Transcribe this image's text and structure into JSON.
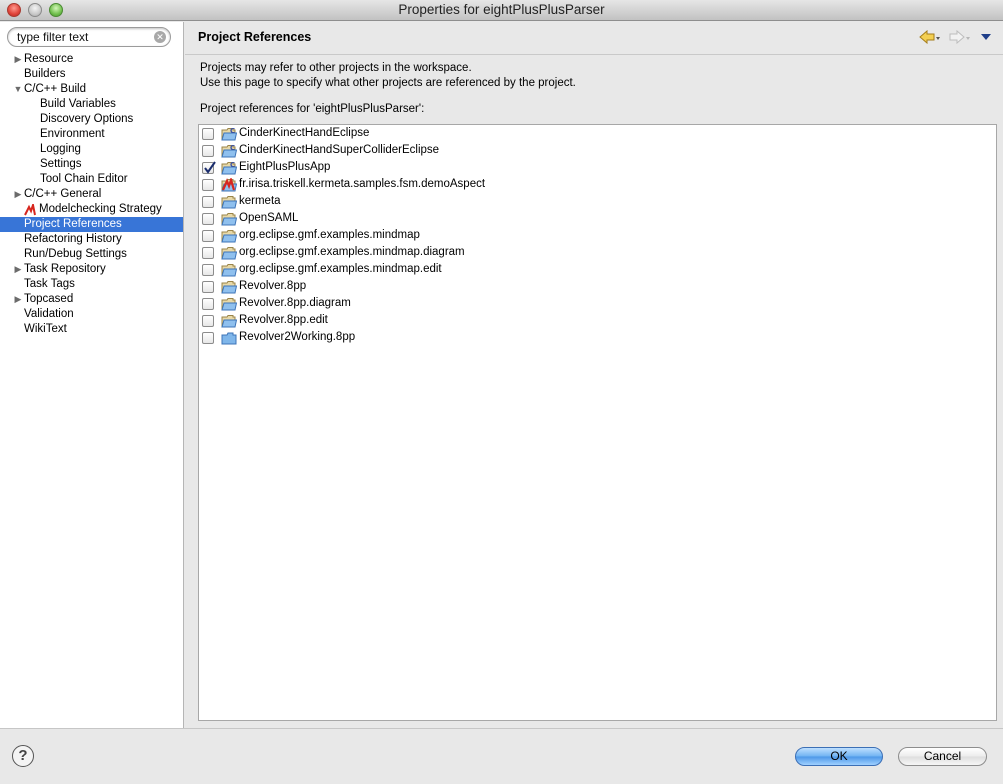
{
  "window": {
    "title": "Properties for eightPlusPlusParser"
  },
  "filter": {
    "value": "type filter text"
  },
  "tree": [
    {
      "label": "Resource",
      "level": 0,
      "expander": "collapsed",
      "selected": false
    },
    {
      "label": "Builders",
      "level": 0,
      "expander": "none",
      "selected": false
    },
    {
      "label": "C/C++ Build",
      "level": 0,
      "expander": "expanded",
      "selected": false
    },
    {
      "label": "Build Variables",
      "level": 1,
      "expander": "none",
      "selected": false
    },
    {
      "label": "Discovery Options",
      "level": 1,
      "expander": "none",
      "selected": false
    },
    {
      "label": "Environment",
      "level": 1,
      "expander": "none",
      "selected": false
    },
    {
      "label": "Logging",
      "level": 1,
      "expander": "none",
      "selected": false
    },
    {
      "label": "Settings",
      "level": 1,
      "expander": "none",
      "selected": false
    },
    {
      "label": "Tool Chain Editor",
      "level": 1,
      "expander": "none",
      "selected": false
    },
    {
      "label": "C/C++ General",
      "level": 0,
      "expander": "collapsed",
      "selected": false
    },
    {
      "label": "Modelchecking Strategy",
      "level": 0,
      "expander": "none",
      "selected": false,
      "icon": "kermeta-icon"
    },
    {
      "label": "Project References",
      "level": 0,
      "expander": "none",
      "selected": true
    },
    {
      "label": "Refactoring History",
      "level": 0,
      "expander": "none",
      "selected": false
    },
    {
      "label": "Run/Debug Settings",
      "level": 0,
      "expander": "none",
      "selected": false
    },
    {
      "label": "Task Repository",
      "level": 0,
      "expander": "collapsed",
      "selected": false
    },
    {
      "label": "Task Tags",
      "level": 0,
      "expander": "none",
      "selected": false
    },
    {
      "label": "Topcased",
      "level": 0,
      "expander": "collapsed",
      "selected": false
    },
    {
      "label": "Validation",
      "level": 0,
      "expander": "none",
      "selected": false
    },
    {
      "label": "WikiText",
      "level": 0,
      "expander": "none",
      "selected": false
    }
  ],
  "page": {
    "title": "Project References",
    "description_line1": "Projects may refer to other projects in the workspace.",
    "description_line2": "Use this page to specify what other projects are referenced by the project.",
    "references_label": "Project references for 'eightPlusPlusParser':"
  },
  "projects": [
    {
      "name": "CinderKinectHandEclipse",
      "checked": false,
      "icon": "c-project-folder-icon"
    },
    {
      "name": "CinderKinectHandSuperColliderEclipse",
      "checked": false,
      "icon": "c-project-folder-icon"
    },
    {
      "name": "EightPlusPlusApp",
      "checked": true,
      "icon": "c-project-folder-icon"
    },
    {
      "name": "fr.irisa.triskell.kermeta.samples.fsm.demoAspect",
      "checked": false,
      "icon": "kermeta-project-icon"
    },
    {
      "name": "kermeta",
      "checked": false,
      "icon": "project-folder-icon"
    },
    {
      "name": "OpenSAML",
      "checked": false,
      "icon": "project-folder-icon"
    },
    {
      "name": "org.eclipse.gmf.examples.mindmap",
      "checked": false,
      "icon": "project-folder-icon"
    },
    {
      "name": "org.eclipse.gmf.examples.mindmap.diagram",
      "checked": false,
      "icon": "project-folder-icon"
    },
    {
      "name": "org.eclipse.gmf.examples.mindmap.edit",
      "checked": false,
      "icon": "project-folder-icon"
    },
    {
      "name": "Revolver.8pp",
      "checked": false,
      "icon": "project-folder-icon"
    },
    {
      "name": "Revolver.8pp.diagram",
      "checked": false,
      "icon": "project-folder-icon"
    },
    {
      "name": "Revolver.8pp.edit",
      "checked": false,
      "icon": "project-folder-icon"
    },
    {
      "name": "Revolver2Working.8pp",
      "checked": false,
      "icon": "closed-project-folder-icon"
    }
  ],
  "buttons": {
    "ok": "OK",
    "cancel": "Cancel",
    "help": "?"
  },
  "colors": {
    "selection": "#3875d7",
    "ok_button": "#6fb2f2"
  }
}
